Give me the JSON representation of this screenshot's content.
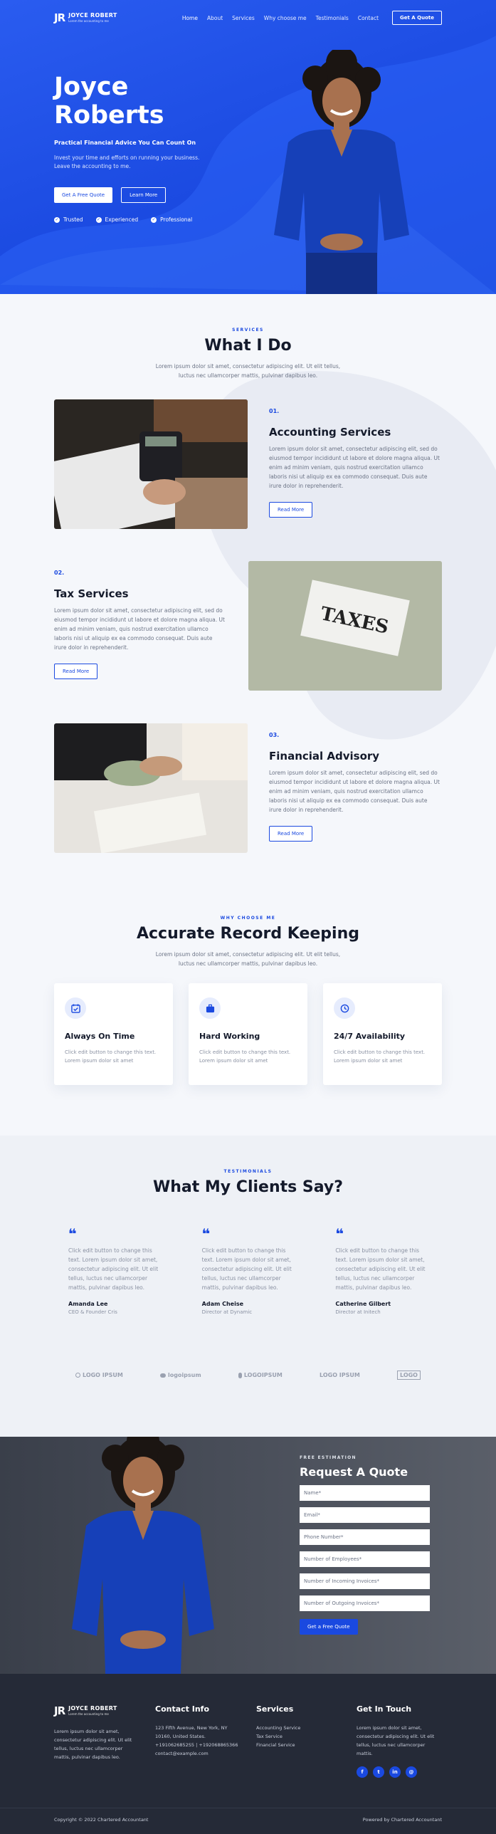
{
  "header": {
    "logo_mark": "JR",
    "logo_name": "JOYCE ROBERT",
    "logo_tagline": "Lorem the accounting to me",
    "nav": [
      "Home",
      "About",
      "Services",
      "Why choose me",
      "Testimonials",
      "Contact"
    ],
    "cta": "Get A Quote"
  },
  "hero": {
    "name_line1": "Joyce",
    "name_line2": "Roberts",
    "subtitle": "Practical Financial Advice You Can Count On",
    "description": "Invest your time and efforts on running your business. Leave the accounting to me.",
    "primary_button": "Get A Free Quote",
    "secondary_button": "Learn More",
    "checks": [
      "Trusted",
      "Experienced",
      "Professional"
    ]
  },
  "services": {
    "kicker": "SERVICES",
    "title": "What I Do",
    "description": "Lorem ipsum dolor sit amet, consectetur adipiscing elit. Ut elit tellus, luctus nec ullamcorper mattis, pulvinar dapibus leo.",
    "items": [
      {
        "num": "01.",
        "title": "Accounting Services",
        "desc": "Lorem ipsum dolor sit amet, consectetur adipiscing elit, sed do eiusmod tempor incididunt ut labore et dolore magna aliqua. Ut enim ad minim veniam, quis nostrud exercitation ullamco laboris nisi ut aliquip ex ea commodo consequat. Duis aute irure dolor in reprehenderit.",
        "button": "Read More"
      },
      {
        "num": "02.",
        "title": "Tax Services",
        "desc": "Lorem ipsum dolor sit amet, consectetur adipiscing elit, sed do eiusmod tempor incididunt ut labore et dolore magna aliqua. Ut enim ad minim veniam, quis nostrud exercitation ullamco laboris nisi ut aliquip ex ea commodo consequat. Duis aute irure dolor in reprehenderit.",
        "button": "Read More",
        "image_text": "TAXES"
      },
      {
        "num": "03.",
        "title": "Financial Advisory",
        "desc": "Lorem ipsum dolor sit amet, consectetur adipiscing elit, sed do eiusmod tempor incididunt ut labore et dolore magna aliqua. Ut enim ad minim veniam, quis nostrud exercitation ullamco laboris nisi ut aliquip ex ea commodo consequat. Duis aute irure dolor in reprehenderit.",
        "button": "Read More"
      }
    ]
  },
  "why": {
    "kicker": "WHY CHOOSE ME",
    "title": "Accurate Record Keeping",
    "description": "Lorem ipsum dolor sit amet, consectetur adipiscing elit. Ut elit tellus, luctus nec ullamcorper mattis, pulvinar dapibus leo.",
    "cards": [
      {
        "icon": "calendar-check-icon",
        "title": "Always On Time",
        "desc": "Click edit button to change this text. Lorem ipsum dolor sit amet"
      },
      {
        "icon": "briefcase-icon",
        "title": "Hard Working",
        "desc": "Click edit button to change this text. Lorem ipsum dolor sit amet"
      },
      {
        "icon": "clock-icon",
        "title": "24/7 Availability",
        "desc": "Click edit button to change this text. Lorem ipsum dolor sit amet"
      }
    ]
  },
  "testimonials": {
    "kicker": "TESTIMONIALS",
    "title": "What My Clients Say?",
    "items": [
      {
        "text": "Click edit button to change this text. Lorem ipsum dolor sit amet, consectetur adipiscing elit. Ut elit tellus, luctus nec ullamcorper mattis, pulvinar dapibus leo.",
        "name": "Amanda Lee",
        "role": "CEO & Founder Cris"
      },
      {
        "text": "Click edit button to change this text. Lorem ipsum dolor sit amet, consectetur adipiscing elit. Ut elit tellus, luctus nec ullamcorper mattis, pulvinar dapibus leo.",
        "name": "Adam Cheise",
        "role": "Director at Dynamic"
      },
      {
        "text": "Click edit button to change this text. Lorem ipsum dolor sit amet, consectetur adipiscing elit. Ut elit tellus, luctus nec ullamcorper mattis, pulvinar dapibus leo.",
        "name": "Catherine Gilbert",
        "role": "Director at Initech"
      }
    ],
    "logos": [
      "LOGO IPSUM",
      "logoipsum",
      "LOGOIPSUM",
      "LOGO IPSUM",
      "LOGO"
    ]
  },
  "quote": {
    "kicker": "FREE ESTIMATION",
    "title": "Request A Quote",
    "fields": [
      "Name*",
      "Email*",
      "Phone Number*",
      "Number of Employees*",
      "Number of Incoming Invoices*",
      "Number of Outgoing Invoices*"
    ],
    "button": "Get a Free Quote"
  },
  "footer": {
    "about": "Lorem ipsum dolor sit amet, consectetur adipiscing elit. Ut elit tellus, luctus nec ullamcorper mattis, pulvinar dapibus leo.",
    "contact_title": "Contact Info",
    "address": "123 Fifth Avenue, New York, NY 10160, United States.",
    "phones": "+1910626852S5 | +192068865366",
    "email": "contact@example.com",
    "services_title": "Services",
    "services": [
      "Accounting Service",
      "Tax Service",
      "Financial Service"
    ],
    "touch_title": "Get In Touch",
    "touch_text": "Lorem ipsum dolor sit amet, consectetur adipiscing elit. Ut elit tellus, luctus nec ullamcorper mattis.",
    "socials": [
      "f",
      "t",
      "in",
      "@"
    ],
    "copyright": "Copyright © 2022 Chartered Accountant",
    "powered": "Powered by Chartered Accountant"
  },
  "colors": {
    "brand": "#1a49e0",
    "dark": "#252a37"
  }
}
